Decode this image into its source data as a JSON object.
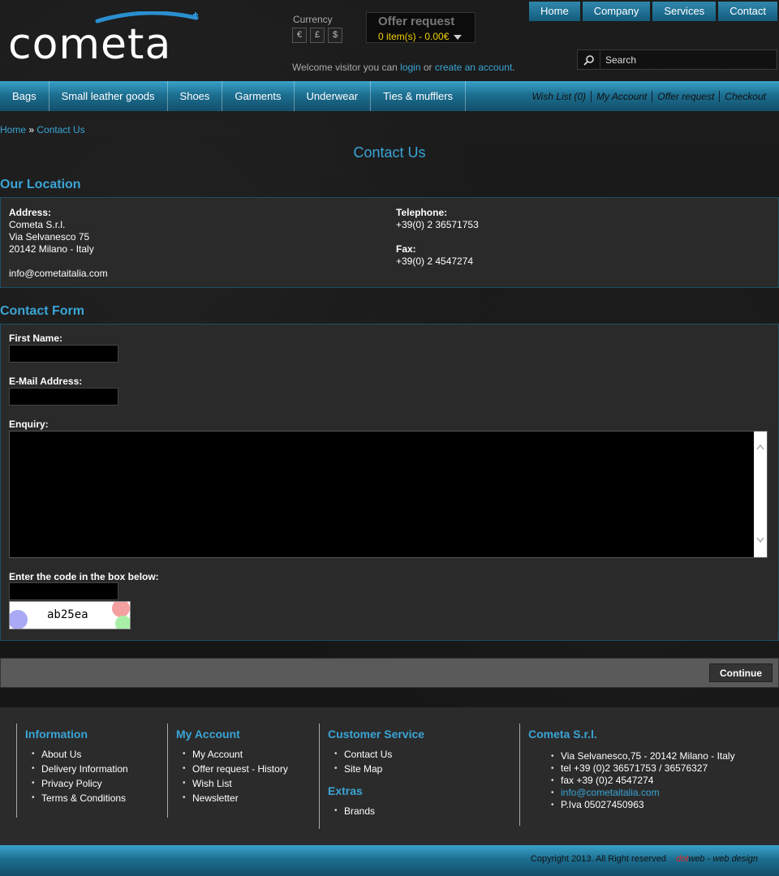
{
  "header": {
    "logo_text": "cometa",
    "currency_label": "Currency",
    "currencies": [
      "€",
      "£",
      "$"
    ],
    "offer_title": "Offer request",
    "offer_items": "0 item(s) - 0.00€",
    "welcome_prefix": "Welcome visitor you can",
    "login": "login",
    "or": "or",
    "create_account": "create an account",
    "period": ".",
    "search_placeholder": "Search",
    "top_nav": [
      "Home",
      "Company",
      "Services",
      "Contact"
    ]
  },
  "nav": {
    "categories": [
      "Bags",
      "Small leather goods",
      "Shoes",
      "Garments",
      "Underwear",
      "Ties & mufflers"
    ],
    "links": [
      "Wish List (0)",
      "My Account",
      "Offer request",
      "Checkout"
    ]
  },
  "breadcrumb": {
    "home": "Home",
    "sep": " » ",
    "current": "Contact Us"
  },
  "page_title": "Contact Us",
  "location": {
    "heading": "Our Location",
    "address_label": "Address:",
    "address_lines": [
      "Cometa S.r.l.",
      "Via Selvanesco 75",
      "20142 Milano - Italy"
    ],
    "email": "info@cometaitalia.com",
    "telephone_label": "Telephone:",
    "telephone": "+39(0) 2 36571753",
    "fax_label": "Fax:",
    "fax": "+39(0) 2 4547274"
  },
  "form": {
    "heading": "Contact Form",
    "first_name_label": "First Name:",
    "email_label": "E-Mail Address:",
    "enquiry_label": "Enquiry:",
    "code_label": "Enter the code in the box below:",
    "captcha": "ab25ea",
    "continue": "Continue"
  },
  "footer": {
    "information": {
      "title": "Information",
      "items": [
        "About Us",
        "Delivery Information",
        "Privacy Policy",
        "Terms & Conditions"
      ]
    },
    "account": {
      "title": "My Account",
      "items": [
        "My Account",
        "Offer request - History",
        "Wish List",
        "Newsletter"
      ]
    },
    "service": {
      "title": "Customer Service",
      "items": [
        "Contact Us",
        "Site Map"
      ]
    },
    "extras": {
      "title": "Extras",
      "items": [
        "Brands"
      ]
    },
    "company": {
      "title": "Cometa S.r.l.",
      "items": [
        "Via Selvanesco,75 - 20142 Milano - Italy",
        "tel  +39 (0)2 36571753 / 36576327",
        "fax +39 (0)2 4547274",
        "info@cometaitalia.com",
        "P.Iva 05027450963"
      ]
    },
    "copyright": "Copyright 2013. All Right reserved",
    "credit_a": "dot",
    "credit_b": "web",
    "credit_sep": " - ",
    "credit_c": "web design"
  },
  "colors": {
    "accent": "#3aa5d6",
    "nav": "#1d6f91",
    "offer": "#f0d000"
  }
}
